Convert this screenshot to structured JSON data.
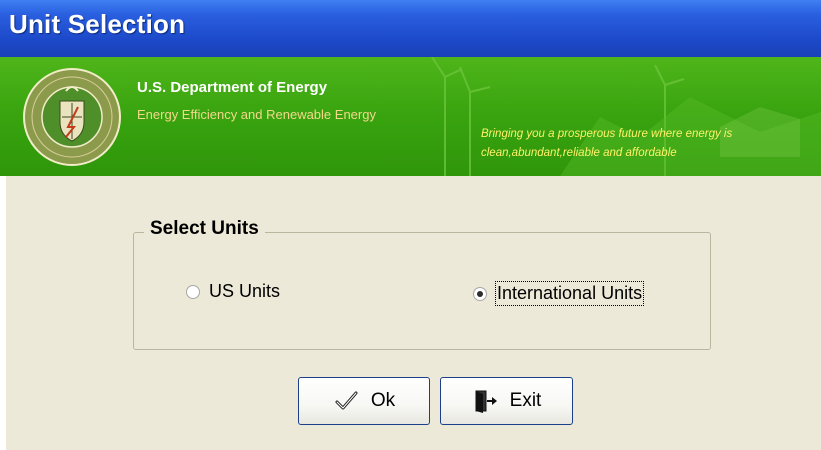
{
  "window": {
    "title": "Unit Selection"
  },
  "banner": {
    "org_name": "U.S. Department of Energy",
    "subtitle": "Energy Efficiency and Renewable Energy",
    "tagline_line1": "Bringing you a prosperous future where energy is",
    "tagline_line2": "clean,abundant,reliable and affordable",
    "seal_icon": "doe-seal-icon",
    "colors": {
      "banner_green": "#38a30f",
      "subtitle_color": "#f3d98a",
      "tagline_color": "#fff36a"
    }
  },
  "units_group": {
    "title": "Select Units",
    "options": [
      {
        "label": "US Units",
        "selected": false
      },
      {
        "label": "International Units",
        "selected": true
      }
    ]
  },
  "buttons": {
    "ok_label": "Ok",
    "ok_icon": "checkmark-icon",
    "exit_label": "Exit",
    "exit_icon": "exit-door-icon"
  },
  "colors": {
    "titlebar_blue": "#2a5fe0",
    "dialog_background": "#ece9d8"
  }
}
